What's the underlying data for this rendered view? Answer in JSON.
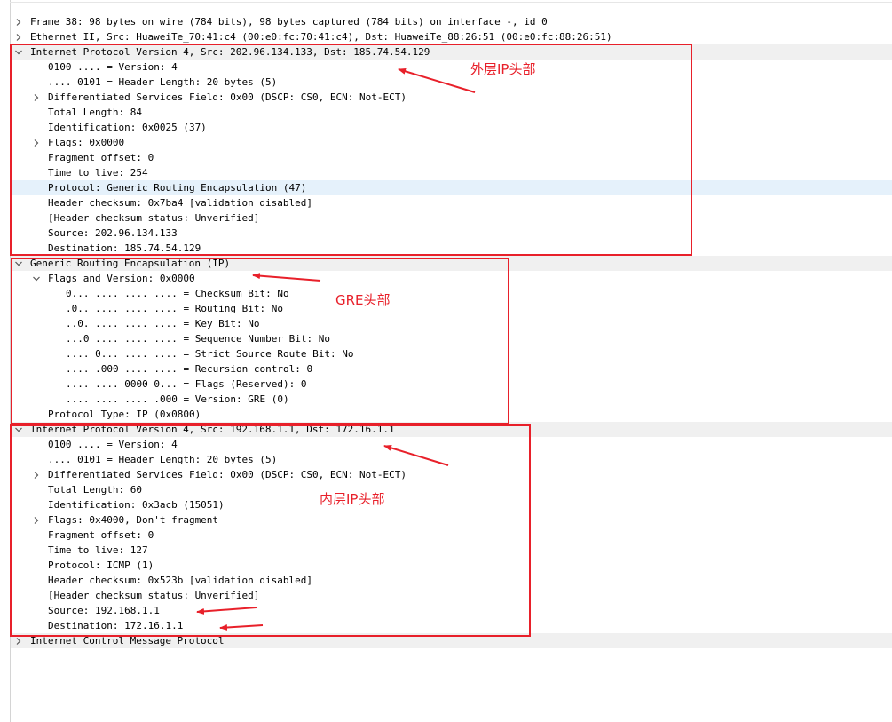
{
  "tree": [
    {
      "text": "Frame 38: 98 bytes on wire (784 bits), 98 bytes captured (784 bits) on interface -, id 0",
      "level": 0,
      "toggle": "collapsed",
      "proto": false
    },
    {
      "text": "Ethernet II, Src: HuaweiTe_70:41:c4 (00:e0:fc:70:41:c4), Dst: HuaweiTe_88:26:51 (00:e0:fc:88:26:51)",
      "level": 0,
      "toggle": "collapsed",
      "proto": false
    },
    {
      "text": "Internet Protocol Version 4, Src: 202.96.134.133, Dst: 185.74.54.129",
      "level": 0,
      "toggle": "expanded",
      "proto": true
    },
    {
      "text": "0100 .... = Version: 4",
      "level": 1,
      "toggle": "none"
    },
    {
      "text": ".... 0101 = Header Length: 20 bytes (5)",
      "level": 1,
      "toggle": "none"
    },
    {
      "text": "Differentiated Services Field: 0x00 (DSCP: CS0, ECN: Not-ECT)",
      "level": 1,
      "toggle": "collapsed"
    },
    {
      "text": "Total Length: 84",
      "level": 1,
      "toggle": "none"
    },
    {
      "text": "Identification: 0x0025 (37)",
      "level": 1,
      "toggle": "none"
    },
    {
      "text": "Flags: 0x0000",
      "level": 1,
      "toggle": "collapsed"
    },
    {
      "text": "Fragment offset: 0",
      "level": 1,
      "toggle": "none"
    },
    {
      "text": "Time to live: 254",
      "level": 1,
      "toggle": "none"
    },
    {
      "text": "Protocol: Generic Routing Encapsulation (47)",
      "level": 1,
      "toggle": "none",
      "selected": true
    },
    {
      "text": "Header checksum: 0x7ba4 [validation disabled]",
      "level": 1,
      "toggle": "none"
    },
    {
      "text": "[Header checksum status: Unverified]",
      "level": 1,
      "toggle": "none"
    },
    {
      "text": "Source: 202.96.134.133",
      "level": 1,
      "toggle": "none"
    },
    {
      "text": "Destination: 185.74.54.129",
      "level": 1,
      "toggle": "none"
    },
    {
      "text": "Generic Routing Encapsulation (IP)",
      "level": 0,
      "toggle": "expanded",
      "proto": true
    },
    {
      "text": "Flags and Version: 0x0000",
      "level": 1,
      "toggle": "expanded"
    },
    {
      "text": "0... .... .... .... = Checksum Bit: No",
      "level": 2,
      "toggle": "none"
    },
    {
      "text": ".0.. .... .... .... = Routing Bit: No",
      "level": 2,
      "toggle": "none"
    },
    {
      "text": "..0. .... .... .... = Key Bit: No",
      "level": 2,
      "toggle": "none"
    },
    {
      "text": "...0 .... .... .... = Sequence Number Bit: No",
      "level": 2,
      "toggle": "none"
    },
    {
      "text": ".... 0... .... .... = Strict Source Route Bit: No",
      "level": 2,
      "toggle": "none"
    },
    {
      "text": ".... .000 .... .... = Recursion control: 0",
      "level": 2,
      "toggle": "none"
    },
    {
      "text": ".... .... 0000 0... = Flags (Reserved): 0",
      "level": 2,
      "toggle": "none"
    },
    {
      "text": ".... .... .... .000 = Version: GRE (0)",
      "level": 2,
      "toggle": "none"
    },
    {
      "text": "Protocol Type: IP (0x0800)",
      "level": 1,
      "toggle": "none"
    },
    {
      "text": "Internet Protocol Version 4, Src: 192.168.1.1, Dst: 172.16.1.1",
      "level": 0,
      "toggle": "expanded",
      "proto": true
    },
    {
      "text": "0100 .... = Version: 4",
      "level": 1,
      "toggle": "none"
    },
    {
      "text": ".... 0101 = Header Length: 20 bytes (5)",
      "level": 1,
      "toggle": "none"
    },
    {
      "text": "Differentiated Services Field: 0x00 (DSCP: CS0, ECN: Not-ECT)",
      "level": 1,
      "toggle": "collapsed"
    },
    {
      "text": "Total Length: 60",
      "level": 1,
      "toggle": "none"
    },
    {
      "text": "Identification: 0x3acb (15051)",
      "level": 1,
      "toggle": "none"
    },
    {
      "text": "Flags: 0x4000, Don't fragment",
      "level": 1,
      "toggle": "collapsed"
    },
    {
      "text": "Fragment offset: 0",
      "level": 1,
      "toggle": "none"
    },
    {
      "text": "Time to live: 127",
      "level": 1,
      "toggle": "none"
    },
    {
      "text": "Protocol: ICMP (1)",
      "level": 1,
      "toggle": "none"
    },
    {
      "text": "Header checksum: 0x523b [validation disabled]",
      "level": 1,
      "toggle": "none"
    },
    {
      "text": "[Header checksum status: Unverified]",
      "level": 1,
      "toggle": "none"
    },
    {
      "text": "Source: 192.168.1.1",
      "level": 1,
      "toggle": "none"
    },
    {
      "text": "Destination: 172.16.1.1",
      "level": 1,
      "toggle": "none"
    },
    {
      "text": "Internet Control Message Protocol",
      "level": 0,
      "toggle": "collapsed",
      "proto": true
    }
  ],
  "annotations": {
    "outer_ip": "外层IP头部",
    "gre": "GRE头部",
    "inner_ip": "内层IP头部",
    "color": "#e8202a"
  },
  "colors": {
    "selected_row": "#e5f1fb",
    "protocol_row": "#f0f0f0",
    "toggle_icon": "#555555"
  }
}
